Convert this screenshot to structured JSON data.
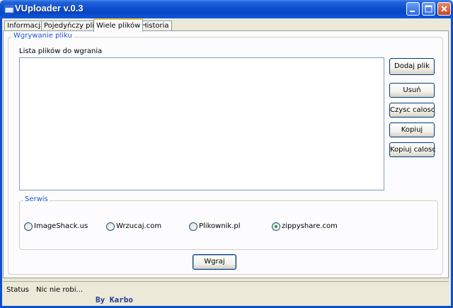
{
  "window": {
    "title": "VUploader v.0.3"
  },
  "tabs": [
    {
      "label": "Informacja"
    },
    {
      "label": "Pojedyńczy plik"
    },
    {
      "label": "Wiele plików"
    },
    {
      "label": "Historia"
    }
  ],
  "upload_group": {
    "legend": "Wgrywanie pliku"
  },
  "file_list": {
    "label": "Lista plików do wgrania"
  },
  "buttons": {
    "add": "Dodaj plik",
    "remove": "Usuń",
    "clear": "Czysc calosc",
    "copy": "Kopiuj",
    "copy_all": "Kopiuj calosc",
    "upload": "Wgraj"
  },
  "service_group": {
    "legend": "Serwis",
    "options": [
      {
        "label": "ImageShack.us",
        "selected": false
      },
      {
        "label": "Wrzucaj.com",
        "selected": false
      },
      {
        "label": "Plikownik.pl",
        "selected": false
      },
      {
        "label": "zippyshare.com",
        "selected": true
      }
    ]
  },
  "status": {
    "label": "Status",
    "value": "Nic nie robi..."
  },
  "footer": {
    "credit": "By Karbo"
  },
  "colors": {
    "accent": "#0b4fd0",
    "legend_text": "#2555c9",
    "credit_text": "#1f3a93"
  }
}
